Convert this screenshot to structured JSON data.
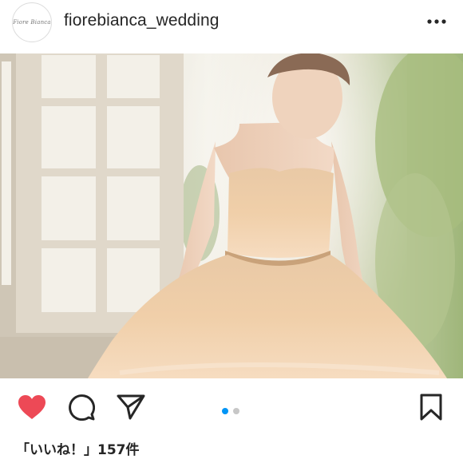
{
  "post": {
    "username": "fiorebianca_wedding",
    "avatar_text": "Fiore Bianca",
    "more_icon": "more-horizontal-icon",
    "likes_text": "「いいね！」157件",
    "carousel": {
      "count": 2,
      "active_index": 0
    }
  },
  "actions": {
    "like_icon": "heart-filled-icon",
    "comment_icon": "comment-icon",
    "share_icon": "send-icon",
    "save_icon": "bookmark-icon"
  },
  "colors": {
    "like": "#ed4956",
    "carousel_active": "#0095f6",
    "carousel_inactive": "#c7c7c7"
  }
}
